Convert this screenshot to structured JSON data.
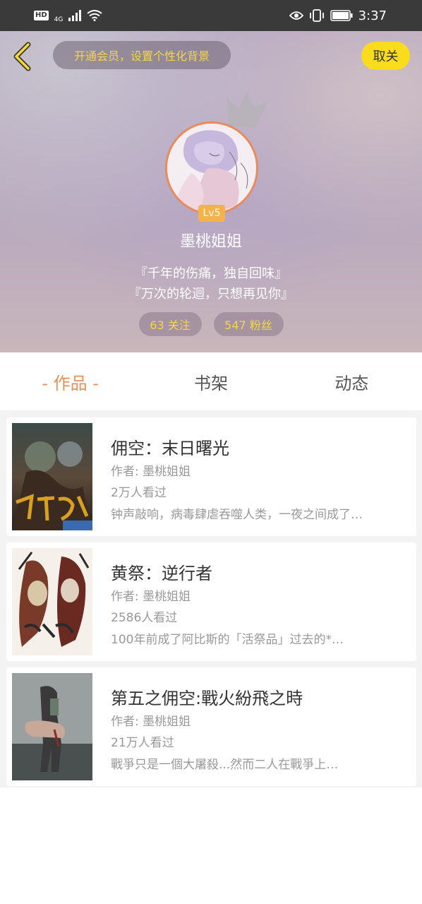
{
  "status_bar": {
    "hd": "HD",
    "network": "4G",
    "time": "3:37",
    "icons": [
      "signal-icon",
      "wifi-icon",
      "eye-icon",
      "vibrate-icon",
      "battery-icon"
    ]
  },
  "header": {
    "vip_banner": "开通会员，设置个性化背景",
    "unfollow_label": "取关",
    "level": "Lv5",
    "username": "墨桃姐姐",
    "bio_line1": "『千年的伤痛，独自回味』",
    "bio_line2": "『万次的轮迴，只想再见你』",
    "following": "63 关注",
    "fans": "547 粉丝"
  },
  "tabs": [
    {
      "label": "- 作品 -",
      "active": true
    },
    {
      "label": "书架",
      "active": false
    },
    {
      "label": "动态",
      "active": false
    }
  ],
  "books": [
    {
      "title": "佣空：末日曙光",
      "author": "作者: 墨桃姐姐",
      "readers": "2万人看过",
      "desc": "钟声敲响，病毒肆虐吞噬人类，一夜之间成了…"
    },
    {
      "title": "黄祭：逆行者",
      "author": "作者: 墨桃姐姐",
      "readers": "2586人看过",
      "desc": "100年前成了阿比斯的「活祭品」过去的*…"
    },
    {
      "title": "第五之佣空:戰火紛飛之時",
      "author": "作者: 墨桃姐姐",
      "readers": "21万人看过",
      "desc": "戰爭只是一個大屠殺...然而二人在戰爭上…"
    }
  ],
  "colors": {
    "accent": "#ea8f54",
    "yellow_button": "#f9dc1c",
    "badge": "#f3b24a",
    "stat_text": "#f5d54a"
  }
}
